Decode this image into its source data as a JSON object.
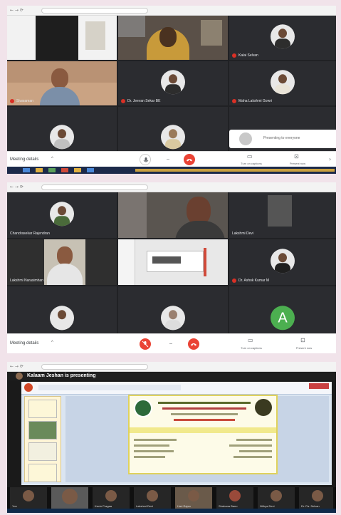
{
  "screenshot1": {
    "meeting_details": "Meeting details",
    "tiles": [
      {
        "name": "",
        "kind": "video"
      },
      {
        "name": "",
        "kind": "video"
      },
      {
        "name": "Kalai Selvan",
        "kind": "avatar"
      },
      {
        "name": "Sivaraman",
        "kind": "video"
      },
      {
        "name": "Dr. Jeevan Sekar BE",
        "kind": "avatar"
      },
      {
        "name": "Maha Lakshmi Gowri",
        "kind": "avatar"
      },
      {
        "name": "",
        "kind": "avatar"
      },
      {
        "name": "",
        "kind": "avatar"
      },
      {
        "name": "Presenting to everyone",
        "kind": "notice"
      }
    ],
    "toolbar": {
      "captions_label": "Turn on captions",
      "present_label": "Present now"
    }
  },
  "screenshot2": {
    "meeting_details": "Meeting details",
    "tiles": [
      {
        "name": "Chandrasekar Rajendran",
        "kind": "avatar"
      },
      {
        "name": "",
        "kind": "video"
      },
      {
        "name": "Lakshmi Devi",
        "kind": "video"
      },
      {
        "name": "Lakshmi Narasimhan",
        "kind": "video"
      },
      {
        "name": "",
        "kind": "screen"
      },
      {
        "name": "Dr. Ashok Kumar M",
        "kind": "avatar"
      },
      {
        "name": "",
        "kind": "avatar"
      },
      {
        "name": "",
        "kind": "avatar"
      },
      {
        "name": "",
        "kind": "letter",
        "letter": "A"
      }
    ],
    "toolbar": {
      "captions_label": "Turn on captions",
      "present_label": "Present now"
    }
  },
  "screenshot3": {
    "presenting_banner": "Kalaam Jeshan is presenting",
    "strip": [
      {
        "name": "You"
      },
      {
        "name": ""
      },
      {
        "name": "Kavin Pragaa"
      },
      {
        "name": "Lakshmi Devi"
      },
      {
        "name": "Hari Rajan"
      },
      {
        "name": "Shahana Banu"
      },
      {
        "name": "Nithya Devi"
      },
      {
        "name": "Dr. Pa. Selvan"
      }
    ]
  },
  "colors": {
    "meet_background": "#202124",
    "end_call": "#ea4335",
    "page_background": "#f1e3ea"
  },
  "icons": {
    "mic": "mic-icon",
    "end_call": "phone-hangup-icon",
    "captions": "captions-icon",
    "present": "present-screen-icon",
    "more": "more-options-icon"
  }
}
